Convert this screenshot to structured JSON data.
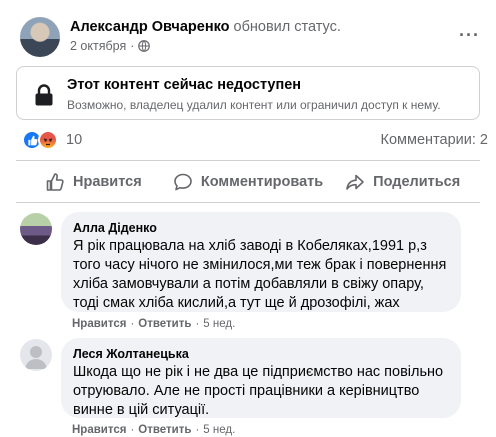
{
  "post": {
    "author_name": "Александр Овчаренко",
    "action": "обновил статус.",
    "date": "2 октября",
    "dot": "·",
    "more_label": "···"
  },
  "unavailable": {
    "title": "Этот контент сейчас недоступен",
    "subtitle": "Возможно, владелец удалил контент или ограничил доступ к нему."
  },
  "reactions": {
    "count": "10",
    "comments": "Комментарии: 2",
    "types": [
      "like",
      "angry"
    ]
  },
  "actions": {
    "like": "Нравится",
    "comment": "Комментировать",
    "share": "Поделиться"
  },
  "comments": [
    {
      "author": "Алла Діденко",
      "text": "Я рік працювала на хліб заводі в Кобеляках,1991 р,з того часу нічого не змінилося,ми теж брак і повернення хліба замовчували а потім добавляли в свіжу опару, тоді смак хліба кислий,а тут ще й дрозофілі, жах",
      "like": "Нравится",
      "reply": "Ответить",
      "time": "5 нед."
    },
    {
      "author": "Леся Жолтанецька",
      "text": "Шкода що не рік і не два це підприємство нас повільно отруювало. Але не прості працівники а керівництво винне в цій ситуації.",
      "like": "Нравится",
      "reply": "Ответить",
      "time": "5 нед."
    }
  ],
  "colors": {
    "brand_blue": "#1877f2",
    "secondary_text": "#65676b",
    "bubble_bg": "#f0f2f5"
  }
}
